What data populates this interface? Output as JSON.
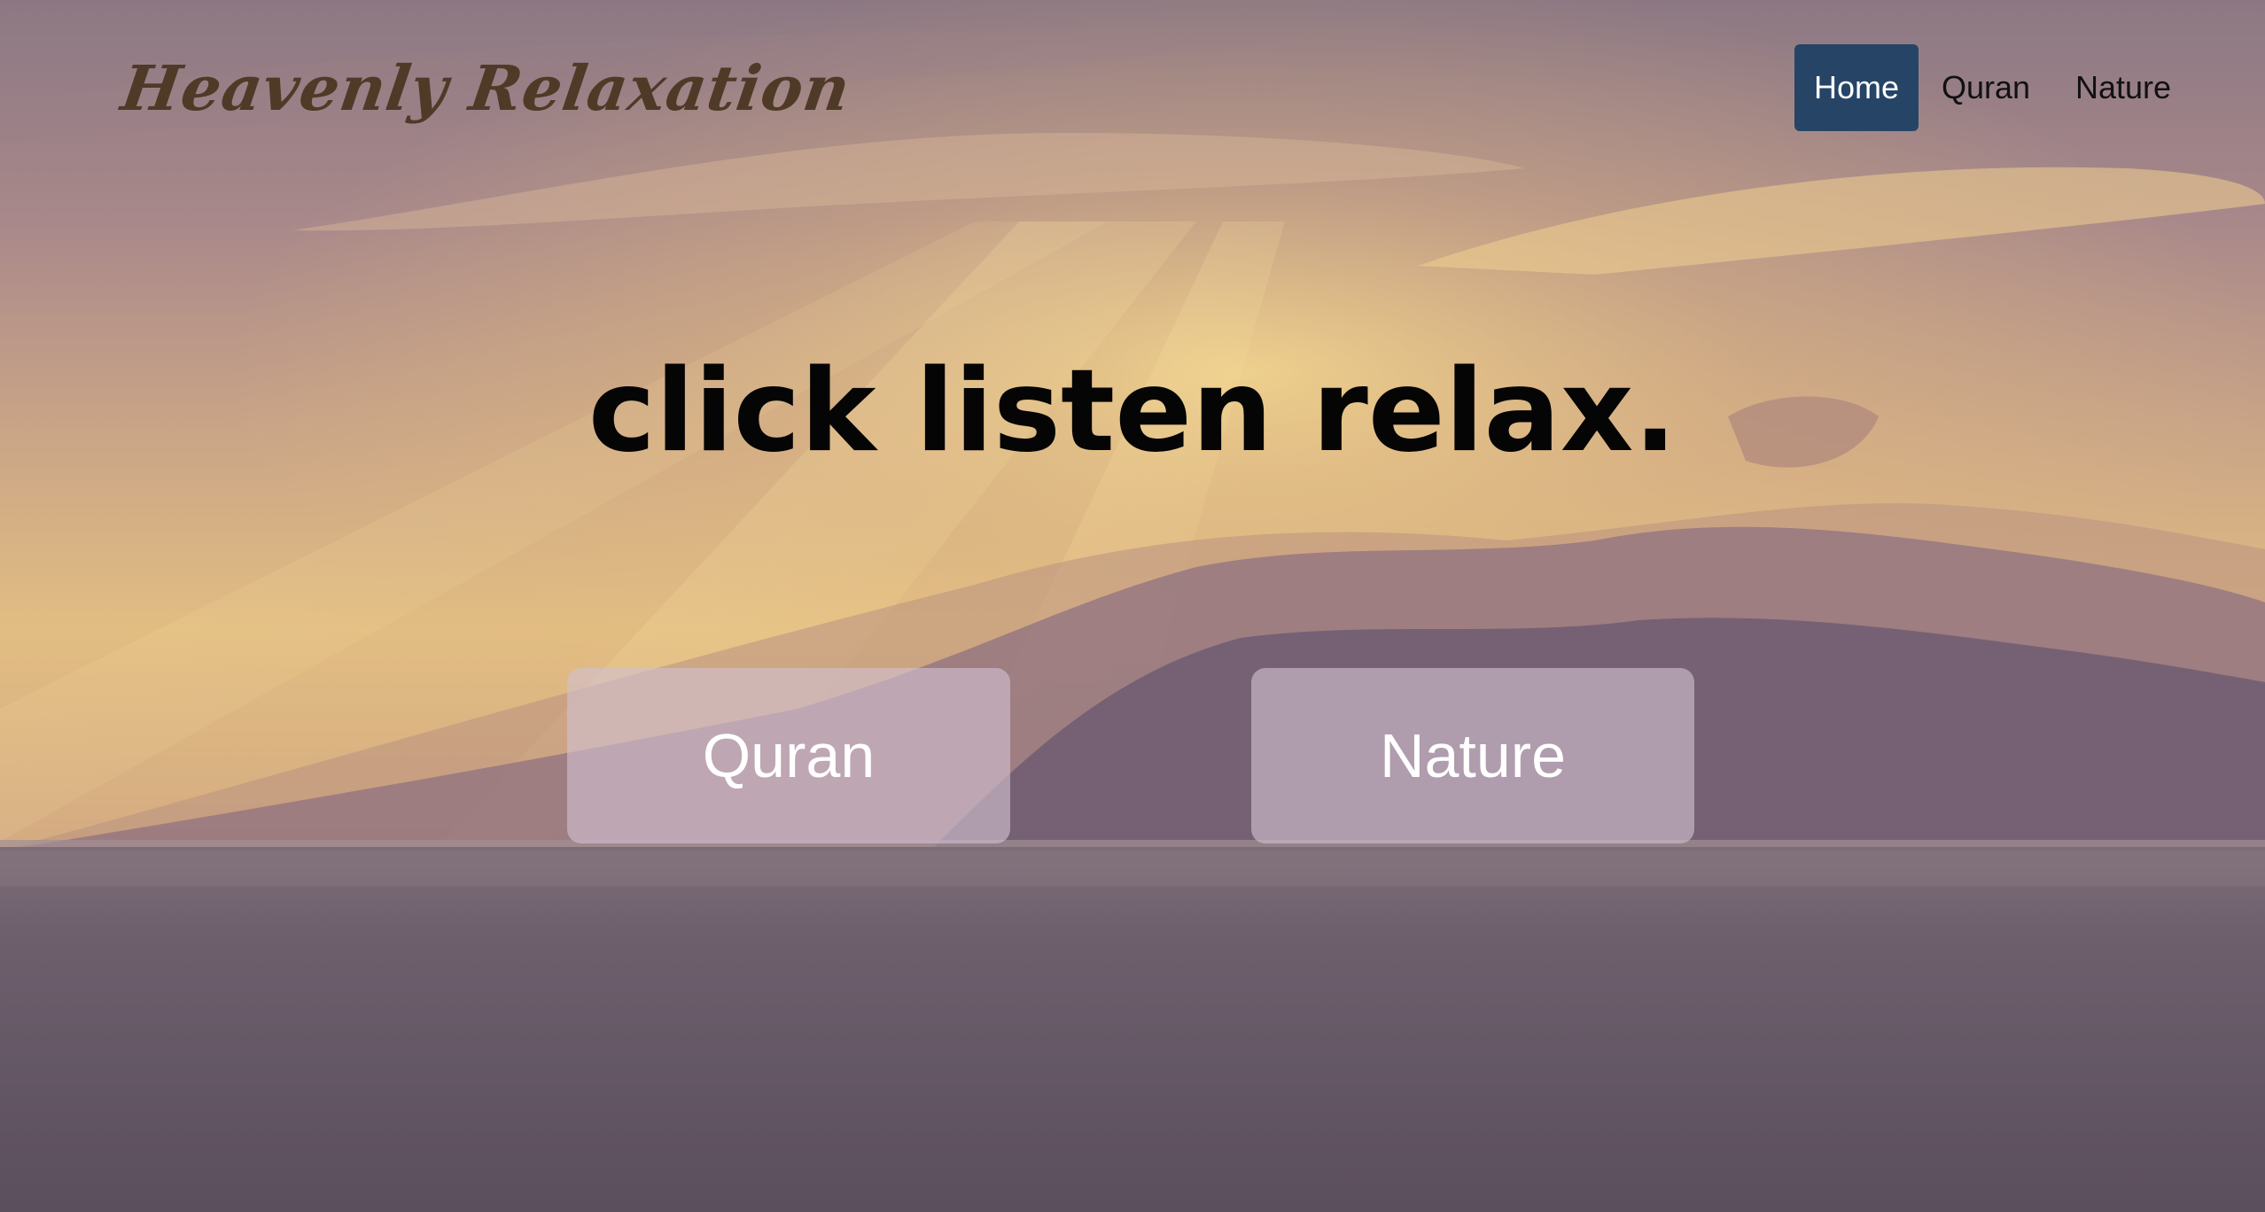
{
  "header": {
    "brand": "Heavenly Relaxation",
    "nav": [
      {
        "label": "Home",
        "active": true
      },
      {
        "label": "Quran",
        "active": false
      },
      {
        "label": "Nature",
        "active": false
      }
    ]
  },
  "hero": {
    "tagline": "click listen relax.",
    "buttons": [
      {
        "label": "Quran"
      },
      {
        "label": "Nature"
      }
    ]
  },
  "colors": {
    "nav_active_bg": "#264466",
    "brand_text": "#4f3a27",
    "button_bg": "rgba(210,192,208,0.62)"
  }
}
